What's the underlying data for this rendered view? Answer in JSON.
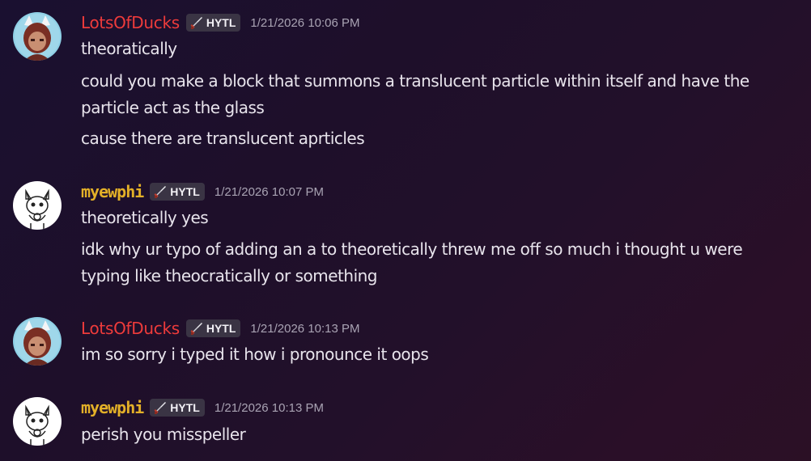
{
  "colors": {
    "lots_name": "#ee3b3b",
    "myew_name": "#e3b028",
    "tag_bg": "#3a3444",
    "timestamp": "#a9a3b3",
    "text": "#e8e4ec"
  },
  "messages": [
    {
      "author": "LotsOfDucks",
      "tag": "HYTL",
      "tag_icon": "sword-icon",
      "timestamp": "1/21/2026 10:06 PM",
      "lines": [
        "theoratically",
        "could you make a block that summons a translucent particle within itself and have the particle act as the glass",
        "cause there are translucent aprticles"
      ]
    },
    {
      "author": "myewphi",
      "tag": "HYTL",
      "tag_icon": "sword-icon",
      "timestamp": "1/21/2026 10:07 PM",
      "lines": [
        "theoretically yes",
        "idk why ur typo of adding an a to theoretically threw me off so much i thought u were typing like theocratically or something"
      ]
    },
    {
      "author": "LotsOfDucks",
      "tag": "HYTL",
      "tag_icon": "sword-icon",
      "timestamp": "1/21/2026 10:13 PM",
      "lines": [
        "im so sorry i typed it how i pronounce it oops"
      ]
    },
    {
      "author": "myewphi",
      "tag": "HYTL",
      "tag_icon": "sword-icon",
      "timestamp": "1/21/2026 10:13 PM",
      "lines": [
        "perish you misspeller"
      ]
    }
  ]
}
